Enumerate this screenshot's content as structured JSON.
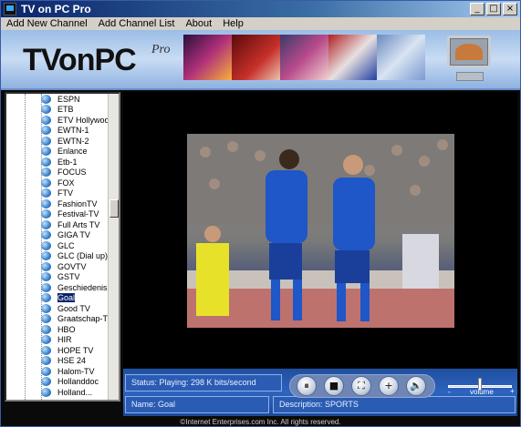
{
  "window": {
    "title": "TV on PC Pro"
  },
  "title_buttons": {
    "minimize": "_",
    "maximize": "□",
    "close": "×"
  },
  "menu": [
    "Add New Channel",
    "Add Channel List",
    "About",
    "Help"
  ],
  "banner": {
    "logo": "TVonPC",
    "logo_suffix": "Pro"
  },
  "channels": [
    "ESPN",
    "ETB",
    "ETV Hollywood",
    "EWTN-1",
    "EWTN-2",
    "Enlance",
    "Etb-1",
    "FOCUS",
    "FOX",
    "FTV",
    "FashionTV",
    "Festival-TV",
    "Full Arts TV",
    "GIGA TV",
    "GLC",
    "GLC (Dial up)",
    "GOVTV",
    "GSTV",
    "Geschiedenis",
    "Goal",
    "Good TV",
    "Graatschap-TV",
    "HBO",
    "HIR",
    "HOPE TV",
    "HSE 24",
    "Halom-TV",
    "Hollanddoc",
    "Holland..."
  ],
  "selected_channel": "Goal",
  "controls": {
    "status": "Status: Playing: 298 K bits/second",
    "name": "Name: Goal",
    "description": "Description: SPORTS",
    "play_pause": "⏸",
    "stop": "■",
    "fullscreen": "⛶",
    "zoom": "+",
    "volume_icon": "🔈",
    "volume_label": "volume",
    "volume_minus": "-",
    "volume_plus": "+",
    "volume_level": 0.5
  },
  "footer": "©Internet Enterprises.com Inc. All rights reserved.",
  "colors": {
    "titlebar": "#0a246a",
    "control_panel": "#2d64bf",
    "selection": "#0a246a"
  }
}
